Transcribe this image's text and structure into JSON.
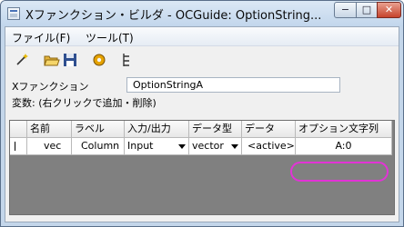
{
  "window": {
    "title": "Xファンクション・ビルダ - OCGuide: OptionString...",
    "controls": {
      "minimize": "−",
      "maximize": "□",
      "close": "✕"
    }
  },
  "menu": {
    "items": [
      {
        "label": "ファイル(F)"
      },
      {
        "label": "ツール(T)"
      }
    ]
  },
  "toolbar": {
    "icons": [
      "new-icon",
      "open-folder-icon",
      "save-icon",
      "settings-gear-icon",
      "tree-view-icon"
    ]
  },
  "xfunction": {
    "label": "Xファンクション",
    "value": "OptionStringA"
  },
  "variables_hint": "変数: (右クリックで追加・削除)",
  "grid": {
    "headers": [
      "名前",
      "ラベル",
      "入力/出力",
      "データ型",
      "データ",
      "オプション文字列"
    ],
    "rows": [
      {
        "name": "vec",
        "label": "Column",
        "io": "Input",
        "type": "vector",
        "data": "<active>",
        "option": "A:0"
      }
    ]
  },
  "colors": {
    "highlight": "#e233d6",
    "grid_bg": "#808080"
  }
}
